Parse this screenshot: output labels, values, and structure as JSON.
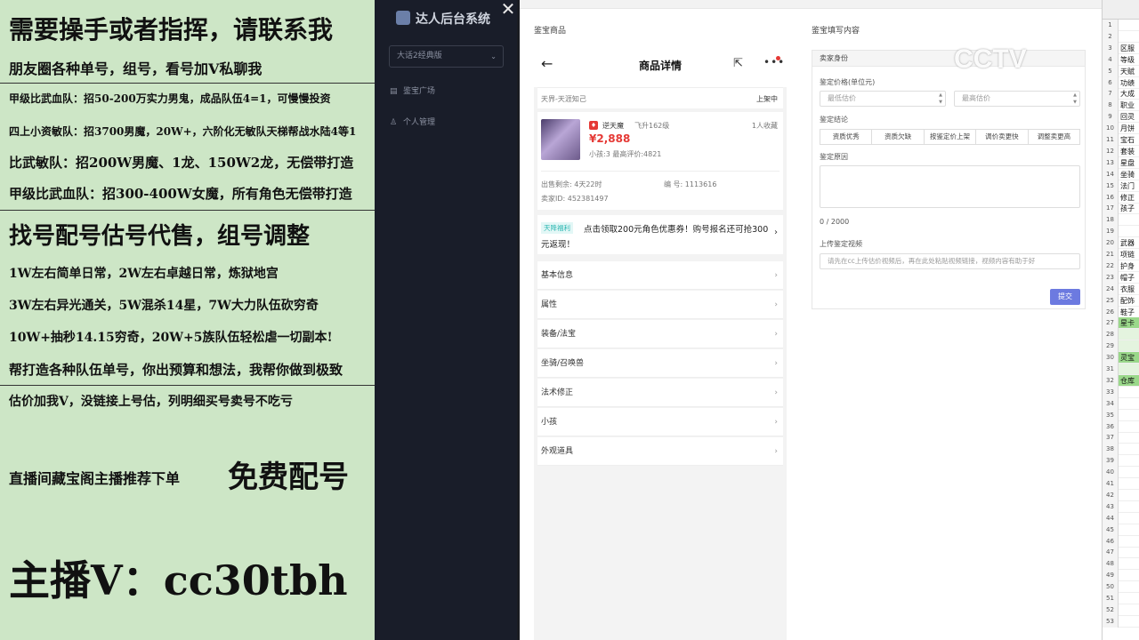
{
  "promo": {
    "lines": [
      "需要操手或者指挥，请联系我",
      "朋友圈各种单号，组号，看号加V私聊我",
      "甲级比武血队：招50-200万实力男鬼，成品队伍4=1，可慢慢投资",
      "四上小资敏队：招3700男魔，20W+，六阶化无敏队天梯帮战水陆4等1",
      "比武敏队：招200W男魔、1龙、150W2龙，无偿带打造",
      "甲级比武血队：招300-400W女魔，所有角色无偿带打造",
      "找号配号估号代售，组号调整",
      "1W左右简单日常，2W左右卓越日常，炼狱地宫",
      "3W左右异光通关，5W混杀14星，7W大力队伍砍穷奇",
      "10W+抽秒14.15穷奇，20W+5族队伍轻松虐一切副本!",
      "帮打造各种队伍单号，你出预算和想法，我帮你做到极致",
      "估价加我V，没链接上号估，列明细买号卖号不吃亏",
      "直播间藏宝阁主播推荐下单",
      "免费配号",
      "主播V：cc30tbh"
    ]
  },
  "admin": {
    "brand": "达人后台系统",
    "select_value": "大话2经典版",
    "nav": [
      {
        "label": "鉴宝广场",
        "icon": "shop-icon"
      },
      {
        "label": "个人管理",
        "icon": "user-icon"
      }
    ],
    "close_glyph": "✕"
  },
  "main": {
    "left_title": "鉴宝商品",
    "right_title": "鉴宝填写内容"
  },
  "phone": {
    "title": "商品详情",
    "server": "天界-天涯知己",
    "status": "上架中",
    "char_name": "逆天魔",
    "char_level": "飞升162级",
    "favorites": "1人收藏",
    "price": "¥2,888",
    "kids_eval": "小孩:3 最高评价:4821",
    "time_left": "出售剩余: 4天22时",
    "item_no": "编 号: 1113616",
    "seller_id": "卖家ID: 452381497",
    "promo_tag": "天降福利",
    "promo_text": "点击领取200元角色优惠券！购号报名还可抢300元返现！",
    "rows": [
      "基本信息",
      "属性",
      "装备/法宝",
      "坐骑/召唤兽",
      "法术修正",
      "小孩",
      "外观道具"
    ]
  },
  "form": {
    "identity_title": "卖家身份",
    "price_label": "鉴定价格(单位元)",
    "min_placeholder": "最低估价",
    "max_placeholder": "最高估价",
    "conclusion_label": "鉴定结论",
    "conclusion_buttons": [
      "资质优秀",
      "资质欠缺",
      "按鉴定价上架",
      "调价卖更快",
      "调整卖更高"
    ],
    "reason_label": "鉴定原因",
    "counter": "0 / 2000",
    "video_label": "上传鉴定视频",
    "video_placeholder": "请先在cc上传估价视频后，再在此处粘贴视频链接，视频内容有助于好",
    "submit": "提交"
  },
  "watermark": "CCTV",
  "sheet": {
    "rows": [
      "",
      "1",
      "2",
      "3",
      "4",
      "5",
      "6",
      "7",
      "8",
      "9",
      "10",
      "11",
      "12",
      "13",
      "14",
      "15",
      "16",
      "17",
      "18",
      "19",
      "20",
      "21",
      "22",
      "23",
      "24",
      "25",
      "26",
      "27",
      "28",
      "29",
      "30",
      "31",
      "32",
      "33",
      "34",
      "35",
      "36",
      "37",
      "38",
      "39",
      "40",
      "41",
      "42",
      "43",
      "44",
      "45",
      "46",
      "47",
      "48",
      "49",
      "50",
      "51",
      "52",
      "53"
    ],
    "cells": {
      "3": "区服",
      "4": "等级",
      "5": "天赋",
      "6": "功绩",
      "7": "大成",
      "8": "职业",
      "9": "回灵",
      "10": "月饼",
      "11": "宝石",
      "12": "套装",
      "13": "星盘",
      "14": "坐骑",
      "15": "法门",
      "16": "修正",
      "17": "孩子",
      "20": "武器",
      "21": "项链",
      "22": "护身",
      "23": "帽子",
      "24": "衣服",
      "25": "配饰",
      "26": "鞋子",
      "27": "星卡",
      "30": "灵宝",
      "32": "仓库"
    }
  }
}
